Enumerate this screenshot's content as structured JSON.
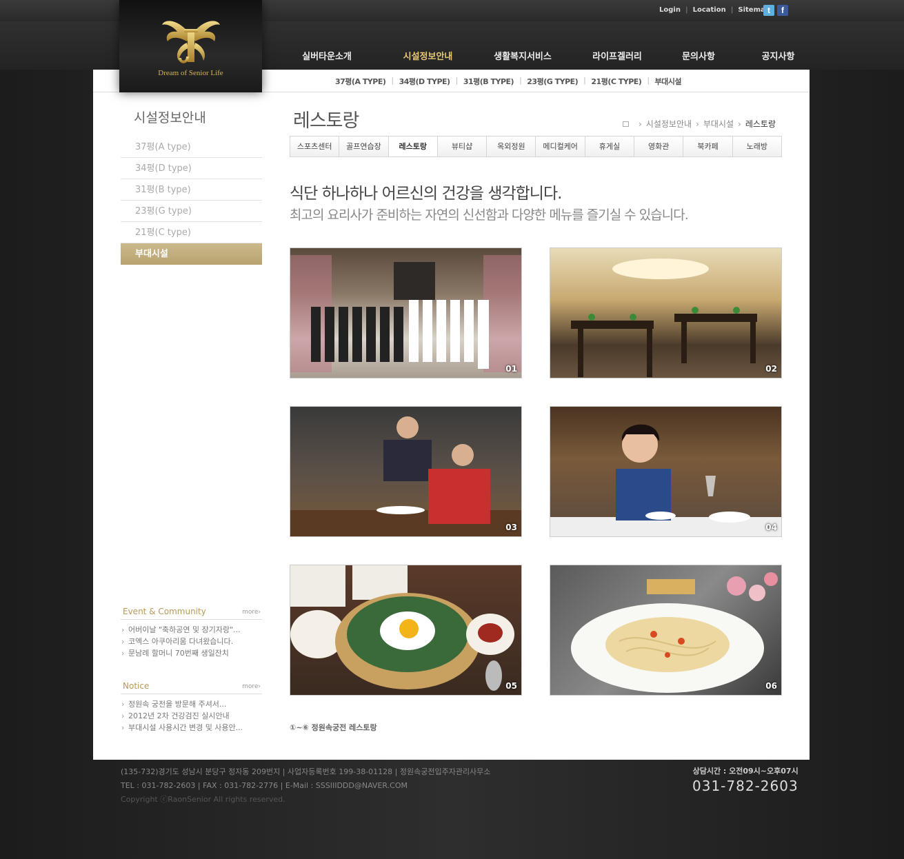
{
  "util_links": [
    "Login",
    "Location",
    "Sitemap"
  ],
  "social": [
    {
      "name": "twitter",
      "glyph": "t"
    },
    {
      "name": "facebook",
      "glyph": "f"
    }
  ],
  "logo": {
    "tagline": "Dream of Senior Life",
    "color": "#d6b45a"
  },
  "gnb": [
    "실버타운소개",
    "시설정보안내",
    "생활복지서비스",
    "라이프겔러리",
    "문의사항",
    "공지사항"
  ],
  "gnb_active": "시설정보안내",
  "subnav": [
    "37평(A TYPE)",
    "34평(D TYPE)",
    "31평(B TYPE)",
    "23평(G TYPE)",
    "21평(C TYPE)",
    "부대시설"
  ],
  "lnb": {
    "title": "시설정보안내",
    "items": [
      "37평(A type)",
      "34평(D type)",
      "31평(B type)",
      "23평(G type)",
      "21평(C type)",
      "부대시설"
    ],
    "active": "부대시설"
  },
  "event": {
    "title": "Event & Community",
    "more": "more›",
    "items": [
      "어버이날 \"축하공연 및 장기자랑\"...",
      "코엑스 아쿠아리움 다녀왔습니다.",
      "문남례 할머니 70번째 생일잔치"
    ]
  },
  "notice": {
    "title": "Notice",
    "more": "more›",
    "items": [
      "정원속 궁전을 방문해 주셔서...",
      "2012년 2차 건강검진 실시안내",
      "부대시설 사용시간 변경 및 사용안..."
    ]
  },
  "page": {
    "title": "레스토랑",
    "breadcrumb": [
      "시설정보안내",
      "부대시설",
      "레스토랑"
    ],
    "tabs": [
      "스포츠센터",
      "골프연습장",
      "레스토랑",
      "뷰티샵",
      "옥외정원",
      "메디컬케어",
      "휴게실",
      "영화관",
      "북카페",
      "노래방"
    ],
    "active_tab": "레스토랑",
    "headline": "식단 하나하나 어르신의 건강을 생각합니다.",
    "subheadline": "최고의 요리사가 준비하는 자연의 신선함과 다양한 메뉴를 즐기실 수 있습니다.",
    "photos": [
      "01",
      "02",
      "03",
      "04",
      "05",
      "06"
    ],
    "caption": "①~⑥ 정원속궁전 레스토랑"
  },
  "footer": {
    "line1": "(135-732)경기도 성남시 분당구 정자동 209번지  |  사업자등록번호 199-38-01128  |  정원속궁전입주자관리사무소",
    "line2": "TEL : 031-782-2603  |  FAX : 031-782-2776  |  E-Mail : SSSIIIDDD@NAVER.COM",
    "copyright": "Copyright ⓒRaonSenior All rights reserved.",
    "hours": "상담시간 : 오전09시~오후07시",
    "phone": "031-782-2603"
  },
  "colors": {
    "accent": "#e8c875",
    "gold": "#b8a36f",
    "bg": "#2a2a2a"
  }
}
